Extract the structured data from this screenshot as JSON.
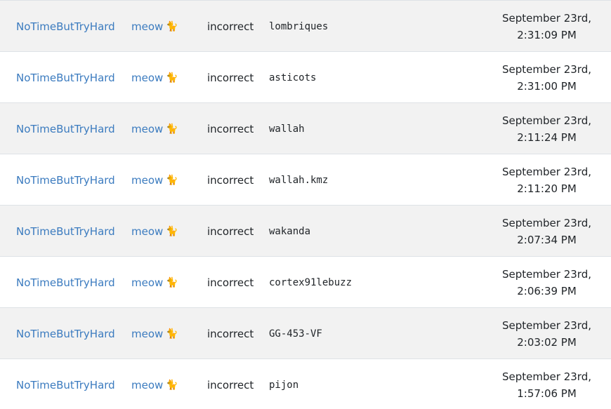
{
  "submissions": [
    {
      "team": "NoTimeButTryHard",
      "user": "meow",
      "user_emoji": "🐈",
      "status": "incorrect",
      "submission": "lombriques",
      "date_line1": "September 23rd,",
      "date_line2": "2:31:09 PM"
    },
    {
      "team": "NoTimeButTryHard",
      "user": "meow",
      "user_emoji": "🐈",
      "status": "incorrect",
      "submission": "asticots",
      "date_line1": "September 23rd,",
      "date_line2": "2:31:00 PM"
    },
    {
      "team": "NoTimeButTryHard",
      "user": "meow",
      "user_emoji": "🐈",
      "status": "incorrect",
      "submission": "wallah",
      "date_line1": "September 23rd,",
      "date_line2": "2:11:24 PM"
    },
    {
      "team": "NoTimeButTryHard",
      "user": "meow",
      "user_emoji": "🐈",
      "status": "incorrect",
      "submission": "wallah.kmz",
      "date_line1": "September 23rd,",
      "date_line2": "2:11:20 PM"
    },
    {
      "team": "NoTimeButTryHard",
      "user": "meow",
      "user_emoji": "🐈",
      "status": "incorrect",
      "submission": "wakanda",
      "date_line1": "September 23rd,",
      "date_line2": "2:07:34 PM"
    },
    {
      "team": "NoTimeButTryHard",
      "user": "meow",
      "user_emoji": "🐈",
      "status": "incorrect",
      "submission": "cortex91lebuzz",
      "date_line1": "September 23rd,",
      "date_line2": "2:06:39 PM"
    },
    {
      "team": "NoTimeButTryHard",
      "user": "meow",
      "user_emoji": "🐈",
      "status": "incorrect",
      "submission": "GG-453-VF",
      "date_line1": "September 23rd,",
      "date_line2": "2:03:02 PM"
    },
    {
      "team": "NoTimeButTryHard",
      "user": "meow",
      "user_emoji": "🐈",
      "status": "incorrect",
      "submission": "pijon",
      "date_line1": "September 23rd,",
      "date_line2": "1:57:06 PM"
    }
  ]
}
